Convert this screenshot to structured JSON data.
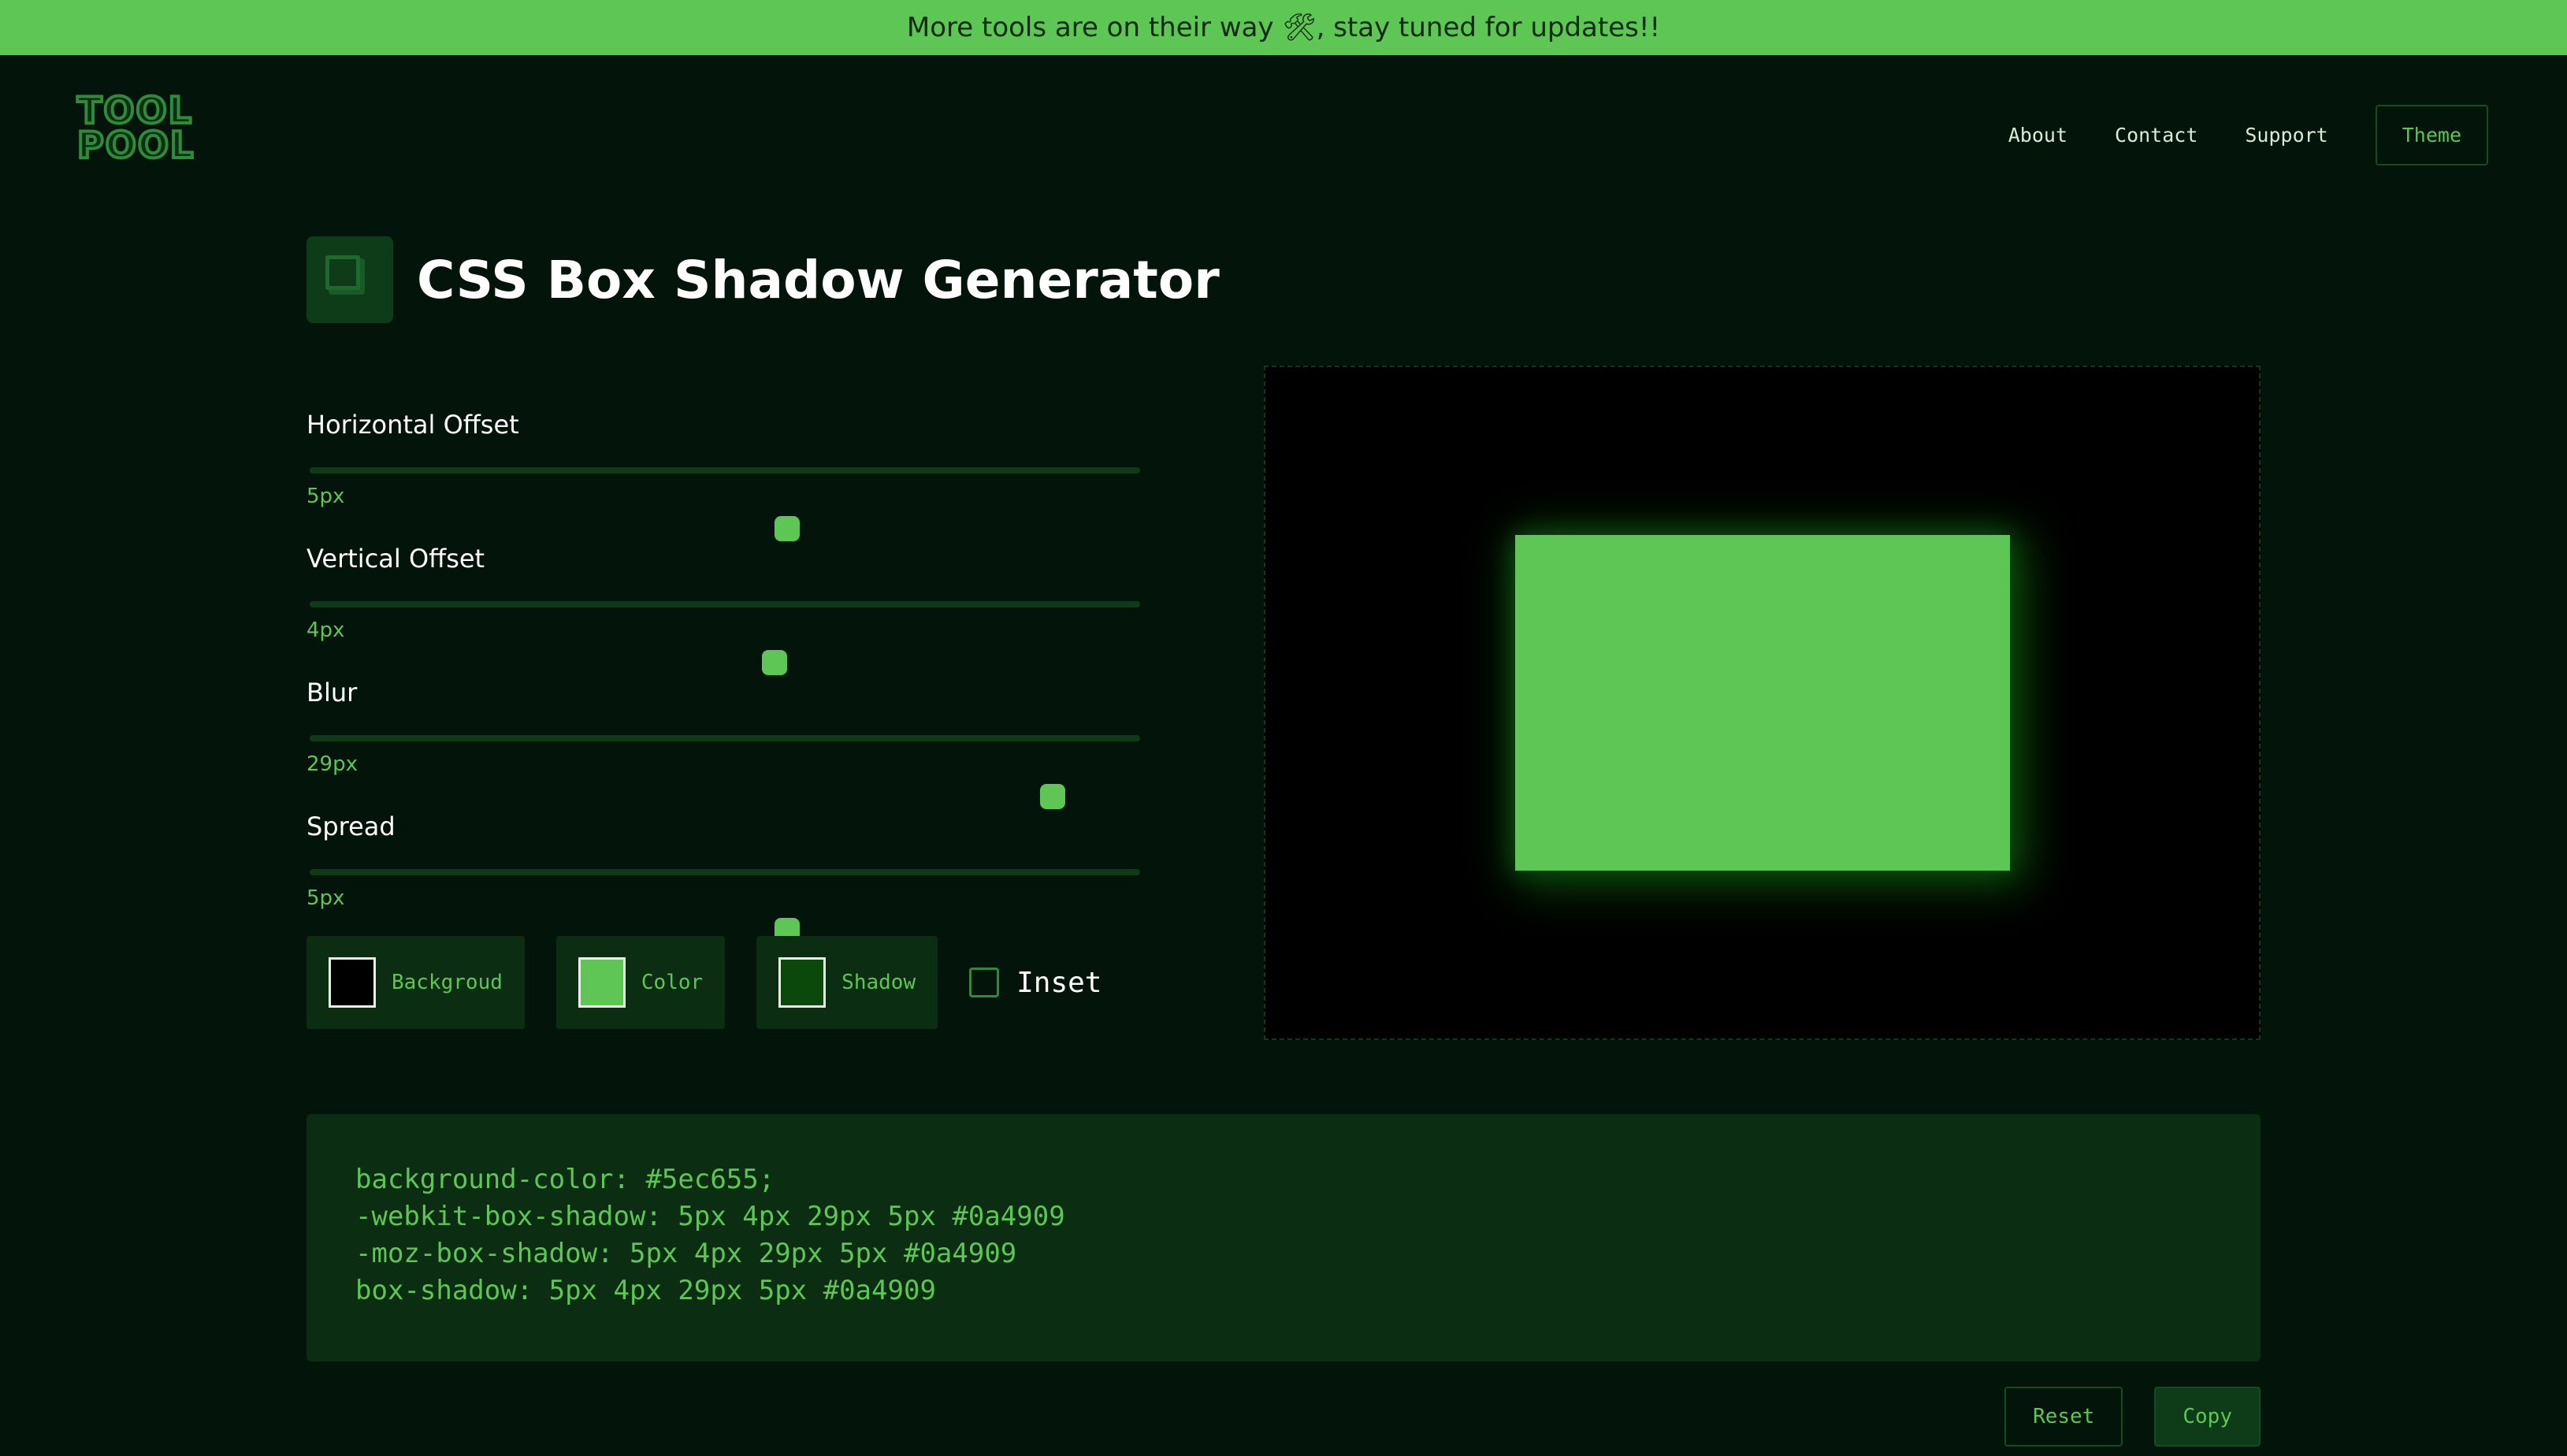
{
  "banner": {
    "text": "More tools are on their way 🛠, stay tuned for updates!!"
  },
  "logo": {
    "line1": "TOOL",
    "line2": "POOL"
  },
  "nav": {
    "about": "About",
    "contact": "Contact",
    "support": "Support",
    "theme": "Theme"
  },
  "page": {
    "title": "CSS Box Shadow Generator",
    "icon": "box-shadow-icon"
  },
  "sliders": [
    {
      "label": "Horizontal Offset",
      "value": "5px",
      "fraction": 0.575
    },
    {
      "label": "Vertical Offset",
      "value": "4px",
      "fraction": 0.56
    },
    {
      "label": "Blur",
      "value": "29px",
      "fraction": 0.895
    },
    {
      "label": "Spread",
      "value": "5px",
      "fraction": 0.575
    }
  ],
  "colors": {
    "background": {
      "label": "Backgroud",
      "hex": "#000000"
    },
    "color": {
      "label": "Color",
      "hex": "#5ec655"
    },
    "shadow": {
      "label": "Shadow",
      "hex": "#0a4909"
    }
  },
  "inset": {
    "label": "Inset",
    "checked": false
  },
  "code": {
    "line1": "background-color: #5ec655;",
    "line2": "-webkit-box-shadow: 5px 4px 29px 5px #0a4909",
    "line3": "-moz-box-shadow: 5px 4px 29px 5px #0a4909",
    "line4": "box-shadow: 5px 4px 29px 5px #0a4909"
  },
  "buttons": {
    "reset": "Reset",
    "copy": "Copy"
  },
  "theme_colors": {
    "accent": "#5ec655",
    "background": "#03140a",
    "panel": "#0b2d12"
  }
}
